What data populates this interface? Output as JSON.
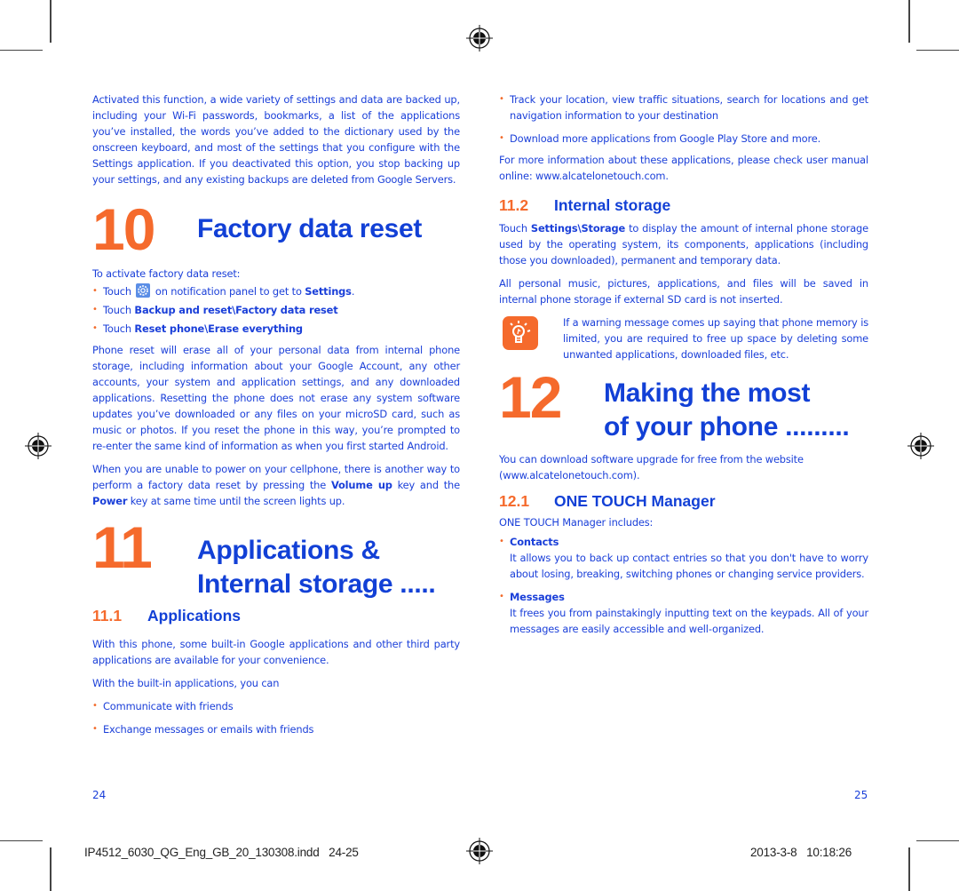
{
  "left_page": {
    "intro_paragraph": "Activated this function, a wide variety of settings and data are backed up, including your Wi-Fi passwords, bookmarks, a list of the applications you’ve installed, the words you’ve added to the dictionary used by the onscreen keyboard, and most of the settings that you configure with the Settings application. If you deactivated this option, you stop backing up your settings, and any existing backups are deleted from Google Servers.",
    "chapter10": {
      "number": "10",
      "title": "Factory data reset",
      "lead": "To activate factory data reset:",
      "steps": [
        {
          "prefix": "Touch ",
          "icon": "settings-gear-icon",
          "middle": " on notification panel to get to ",
          "bold": "Settings",
          "suffix": "."
        },
        {
          "prefix": "Touch ",
          "bold": "Backup and reset\\Factory data reset"
        },
        {
          "prefix": "Touch ",
          "bold": "Reset phone\\Erase everything"
        }
      ],
      "paragraph1": "Phone reset will erase all of your personal data from internal phone storage, including information about your Google Account, any other accounts, your system and application settings, and any downloaded applications. Resetting the phone does not erase any system software updates you’ve downloaded or any files on your microSD card, such as music or photos. If you reset the phone in this way, you’re prompted to re-enter the same kind of information as when you first started Android.",
      "paragraph2": {
        "a": "When you are unable to power on your cellphone, there is another way to perform a factory data reset by pressing the ",
        "b1": "Volume up",
        "c": " key and the ",
        "b2": "Power",
        "d": " key at same time until the screen lights up."
      }
    },
    "chapter11": {
      "number": "11",
      "title_line1": "Applications &",
      "title_line2": "Internal storage .....",
      "section1": {
        "number": "11.1",
        "title": "Applications",
        "paragraph1": "With this phone, some built-in Google applications and other third party applications are available for your convenience.",
        "paragraph2": "With the built-in applications, you can",
        "bullets": [
          "Communicate with friends",
          "Exchange messages or emails with friends"
        ]
      }
    },
    "page_number": "24"
  },
  "right_page": {
    "bullets": [
      "Track your location, view traffic situations, search for locations and get navigation information to your destination",
      "Download more applications from Google Play Store and more."
    ],
    "more_info": "For more information about these applications, please check user manual  online: www.alcatelonetouch.com.",
    "section2": {
      "number": "11.2",
      "title": "Internal storage",
      "paragraph1": {
        "a": "Touch ",
        "bold": "Settings\\Storage",
        "b": " to display the amount of internal phone storage used by the operating system, its components, applications (including those you downloaded), permanent and temporary data."
      },
      "paragraph2": "All personal music, pictures, applications, and files will be saved in internal phone storage if external SD card is not inserted.",
      "tip": {
        "icon": "lightbulb-tip-icon",
        "text": "If a warning message comes up saying that phone memory is limited, you are required to free up space by deleting some unwanted applications, downloaded files, etc."
      }
    },
    "chapter12": {
      "number": "12",
      "title_line1": "Making the most",
      "title_line2": "of your phone .........",
      "paragraph": "You can download software upgrade for free from the website (www.alcatelonetouch.com).",
      "section1": {
        "number": "12.1",
        "title": "ONE TOUCH Manager",
        "lead": "ONE TOUCH Manager includes:",
        "items": [
          {
            "title": "Contacts",
            "desc": "It allows you to back up contact entries so that you don't have to worry about losing, breaking, switching phones or changing service providers."
          },
          {
            "title": "Messages",
            "desc": "It frees you from painstakingly inputting text on the keypads. All of your messages are easily accessible and well-organized."
          }
        ]
      }
    },
    "page_number": "25"
  },
  "slug": {
    "filename": "IP4512_6030_QG_Eng_GB_20_130308.indd   24-25",
    "timestamp": "2013-3-8   10:18:26"
  },
  "colors": {
    "text_blue": "#1a3fd9",
    "heading_blue": "#1240d6",
    "accent_orange": "#f56a2c"
  }
}
